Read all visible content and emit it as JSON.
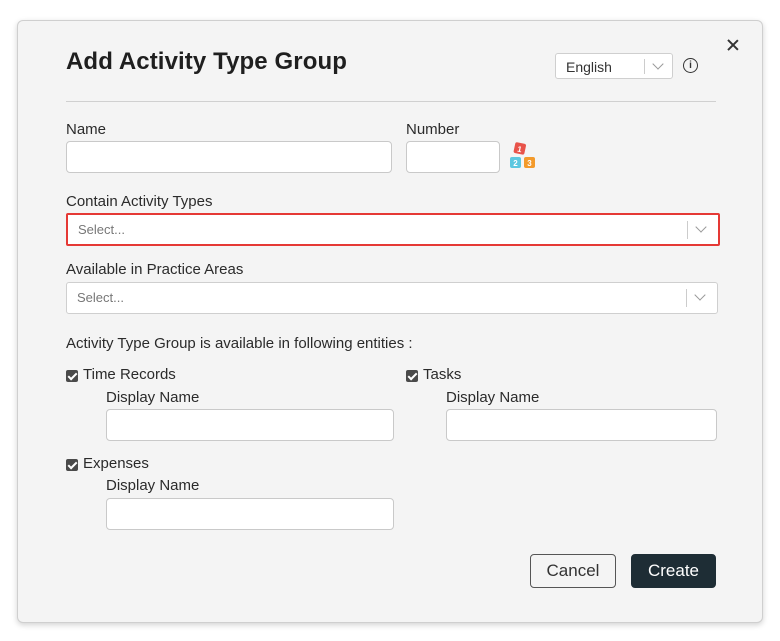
{
  "dialog": {
    "title": "Add Activity Type Group",
    "language": {
      "selected": "English"
    },
    "info_icon": "info-icon",
    "close_icon": "close-icon"
  },
  "fields": {
    "name": {
      "label": "Name",
      "value": ""
    },
    "number": {
      "label": "Number",
      "value": "",
      "generator_icon": "number-generator-icon"
    },
    "contain_activity_types": {
      "label": "Contain Activity Types",
      "placeholder": "Select..."
    },
    "practice_areas": {
      "label": "Available in Practice Areas",
      "placeholder": "Select..."
    }
  },
  "entities": {
    "heading": "Activity Type Group is available in following entities :",
    "time_records": {
      "label": "Time Records",
      "checked": true,
      "display_name_label": "Display Name",
      "display_name_value": ""
    },
    "tasks": {
      "label": "Tasks",
      "checked": true,
      "display_name_label": "Display Name",
      "display_name_value": ""
    },
    "expenses": {
      "label": "Expenses",
      "checked": true,
      "display_name_label": "Display Name",
      "display_name_value": ""
    }
  },
  "actions": {
    "cancel_label": "Cancel",
    "create_label": "Create"
  },
  "colors": {
    "create_button_bg": "#1e2d35",
    "focus_border": "#e53935",
    "dialog_bg": "#f4f4f4"
  }
}
